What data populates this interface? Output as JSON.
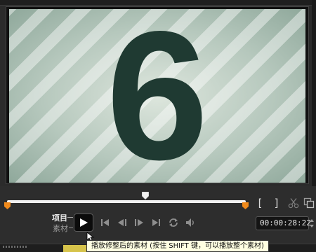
{
  "preview": {
    "countdown_digit": "6",
    "background_color": "#b6c8bd",
    "digit_color": "#1f3a32"
  },
  "playback": {
    "scrub_position": 0.58,
    "mark_in_label": "[",
    "mark_out_label": "]",
    "mode_project_label": "项目",
    "mode_clip_label": "素材",
    "timecode": "00:00:28:22",
    "icons": {
      "play": "play-icon",
      "go_to_start": "skip-start-icon",
      "previous_frame": "step-back-icon",
      "next_frame": "step-forward-icon",
      "go_to_end": "skip-end-icon",
      "repeat": "repeat-icon",
      "volume": "volume-icon",
      "split": "scissors-icon",
      "copy": "copy-icon"
    },
    "accent_color": "#f08a1c"
  },
  "tooltip": {
    "text": "播放修整后的素材 (按住 SHIFT 键，可以播放整个素材)"
  }
}
